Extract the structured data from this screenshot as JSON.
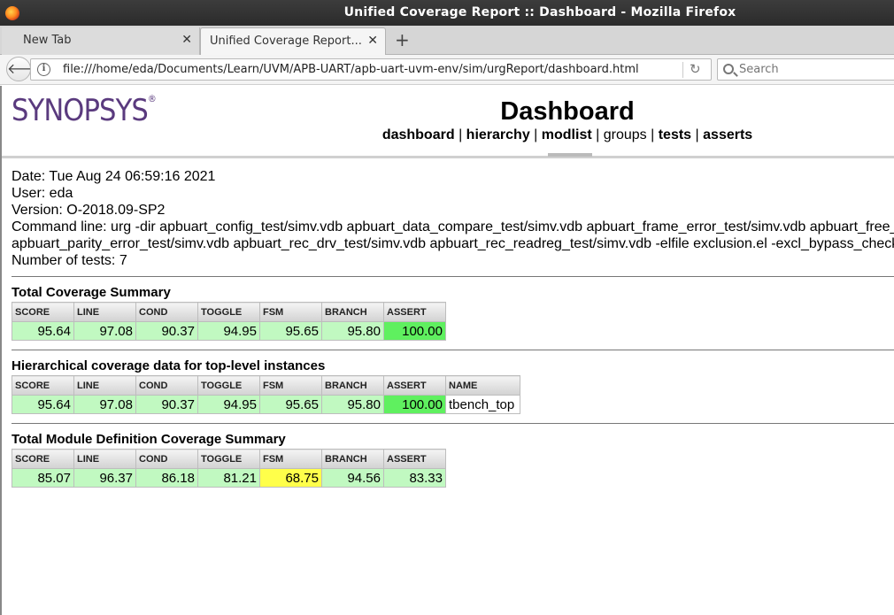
{
  "window": {
    "title": "Unified Coverage Report :: Dashboard - Mozilla Firefox"
  },
  "tabs": [
    {
      "label": "New Tab",
      "active": false
    },
    {
      "label": "Unified Coverage Report...",
      "active": true
    }
  ],
  "navbar": {
    "url": "file:///home/eda/Documents/Learn/UVM/APB-UART/apb-uart-uvm-env/sim/urgReport/dashboard.html",
    "search_placeholder": "Search"
  },
  "header": {
    "logo_text": "SYNOPSYS",
    "logo_mark": "®",
    "title": "Dashboard",
    "links": [
      {
        "label": "dashboard",
        "bold": true
      },
      {
        "label": "hierarchy",
        "bold": true
      },
      {
        "label": "modlist",
        "bold": true
      },
      {
        "label": "groups",
        "bold": false
      },
      {
        "label": "tests",
        "bold": true
      },
      {
        "label": "asserts",
        "bold": true
      }
    ],
    "separator": "|"
  },
  "info": {
    "date": "Date: Tue Aug 24 06:59:16 2021",
    "user": "User: eda",
    "version": "Version: O-2018.09-SP2",
    "command_line_1": "Command line: urg -dir apbuart_config_test/simv.vdb apbuart_data_compare_test/simv.vdb apbuart_frame_error_test/simv.vdb apbuart_free_e",
    "command_line_2": "apbuart_parity_error_test/simv.vdb apbuart_rec_drv_test/simv.vdb apbuart_rec_readreg_test/simv.vdb -elfile exclusion.el -excl_bypass_check",
    "num_tests": "Number of tests: 7"
  },
  "colors": {
    "green": "#c1f9c1",
    "bright_green": "#5ff05f",
    "yellow": "#ffff4a",
    "logo_purple": "#5a3a7e"
  },
  "sections": {
    "total": {
      "title": "Total Coverage Summary",
      "headers": [
        "SCORE",
        "LINE",
        "COND",
        "TOGGLE",
        "FSM",
        "BRANCH",
        "ASSERT"
      ],
      "values": [
        "95.64",
        "97.08",
        "90.37",
        "94.95",
        "95.65",
        "95.80",
        "100.00"
      ],
      "cell_colors": [
        "green",
        "green",
        "green",
        "green",
        "green",
        "green",
        "bright_green"
      ]
    },
    "hier": {
      "title": "Hierarchical coverage data for top-level instances",
      "headers": [
        "SCORE",
        "LINE",
        "COND",
        "TOGGLE",
        "FSM",
        "BRANCH",
        "ASSERT",
        "NAME"
      ],
      "values": [
        "95.64",
        "97.08",
        "90.37",
        "94.95",
        "95.65",
        "95.80",
        "100.00"
      ],
      "name": "tbench_top",
      "cell_colors": [
        "green",
        "green",
        "green",
        "green",
        "green",
        "green",
        "bright_green"
      ]
    },
    "module": {
      "title": "Total Module Definition Coverage Summary",
      "headers": [
        "SCORE",
        "LINE",
        "COND",
        "TOGGLE",
        "FSM",
        "BRANCH",
        "ASSERT"
      ],
      "values": [
        "85.07",
        "96.37",
        "86.18",
        "81.21",
        "68.75",
        "94.56",
        "83.33"
      ],
      "cell_colors": [
        "green",
        "green",
        "green",
        "green",
        "yellow",
        "green",
        "green"
      ]
    }
  }
}
